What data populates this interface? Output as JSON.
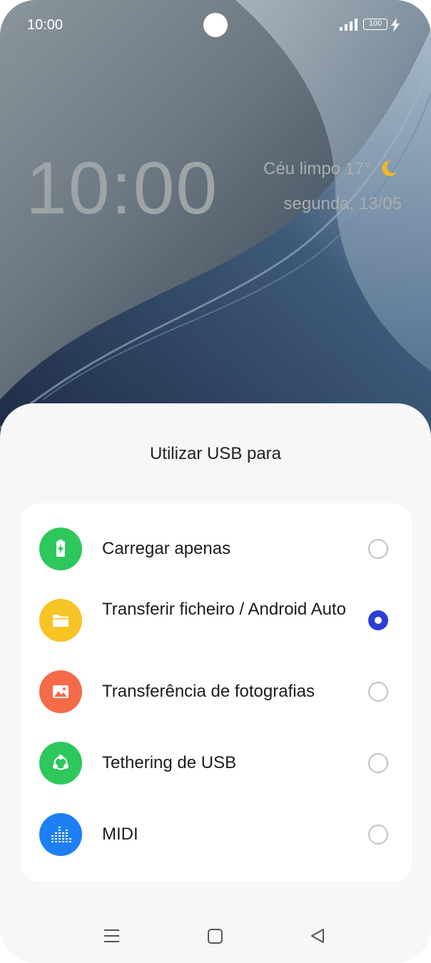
{
  "status_bar": {
    "time": "10:00",
    "battery_level": "100",
    "icons": [
      "signal-icon",
      "battery-icon",
      "charging-bolt-icon"
    ]
  },
  "lock_screen": {
    "clock": "10:00",
    "weather": "Céu limpo 17°",
    "weather_icon": "moon-icon",
    "date": "segunda, 13/05"
  },
  "usb_dialog": {
    "title": "Utilizar USB para",
    "options": [
      {
        "label": "Carregar apenas",
        "icon": "battery-charging-icon",
        "color": "#2dc75c",
        "selected": false
      },
      {
        "label": "Transferir ficheiro / Android Auto",
        "icon": "folder-icon",
        "color": "#f7c325",
        "selected": true
      },
      {
        "label": "Transferência de fotografias",
        "icon": "image-icon",
        "color": "#f56a48",
        "selected": false
      },
      {
        "label": "Tethering de USB",
        "icon": "share-network-icon",
        "color": "#2dc75c",
        "selected": false
      },
      {
        "label": "MIDI",
        "icon": "equalizer-icon",
        "color": "#1e7ff5",
        "selected": false
      }
    ],
    "accent_color": "#2b3ed6"
  },
  "navigation_bar": {
    "buttons": [
      "menu-icon",
      "home-icon",
      "back-icon"
    ]
  }
}
